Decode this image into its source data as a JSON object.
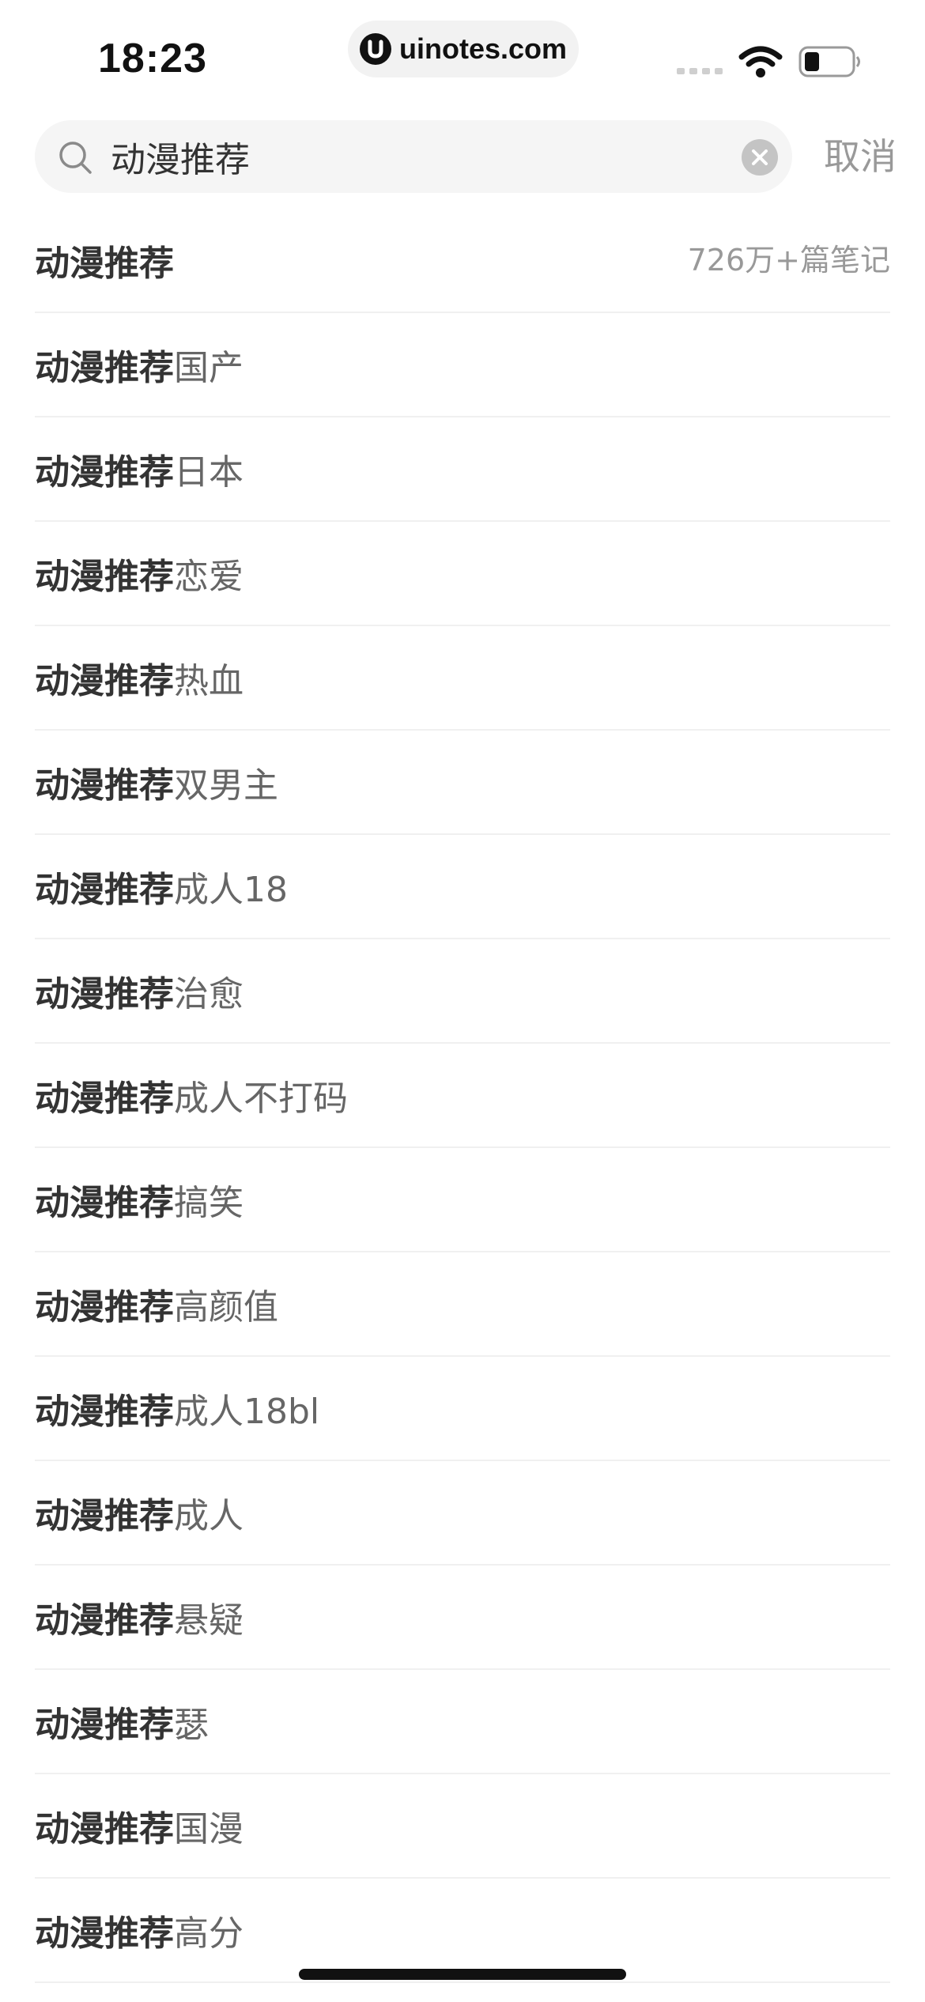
{
  "status_bar": {
    "time": "18:23",
    "url": "uinotes.com",
    "icons": [
      "cellular-signal-icon",
      "wifi-icon",
      "battery-icon"
    ]
  },
  "search": {
    "value": "动漫推荐",
    "placeholder": "",
    "cancel_label": "取消",
    "icons": [
      "search-icon",
      "clear-icon"
    ]
  },
  "suggestions": [
    {
      "match": "动漫推荐",
      "rest": "",
      "count": "726万+篇笔记"
    },
    {
      "match": "动漫推荐",
      "rest": "国产"
    },
    {
      "match": "动漫推荐",
      "rest": "日本"
    },
    {
      "match": "动漫推荐",
      "rest": "恋爱"
    },
    {
      "match": "动漫推荐",
      "rest": "热血"
    },
    {
      "match": "动漫推荐",
      "rest": "双男主"
    },
    {
      "match": "动漫推荐",
      "rest": "成人18"
    },
    {
      "match": "动漫推荐",
      "rest": "治愈"
    },
    {
      "match": "动漫推荐",
      "rest": "成人不打码"
    },
    {
      "match": "动漫推荐",
      "rest": "搞笑"
    },
    {
      "match": "动漫推荐",
      "rest": "高颜值"
    },
    {
      "match": "动漫推荐",
      "rest": "成人18bl"
    },
    {
      "match": "动漫推荐",
      "rest": "成人"
    },
    {
      "match": "动漫推荐",
      "rest": "悬疑"
    },
    {
      "match": "动漫推荐",
      "rest": "瑟"
    },
    {
      "match": "动漫推荐",
      "rest": "国漫"
    },
    {
      "match": "动漫推荐",
      "rest": "高分"
    }
  ],
  "colors": {
    "text_primary": "#333333",
    "text_secondary": "#666666",
    "text_muted": "#999999",
    "search_bg": "#f5f5f5",
    "divider": "#f0f0f0"
  }
}
